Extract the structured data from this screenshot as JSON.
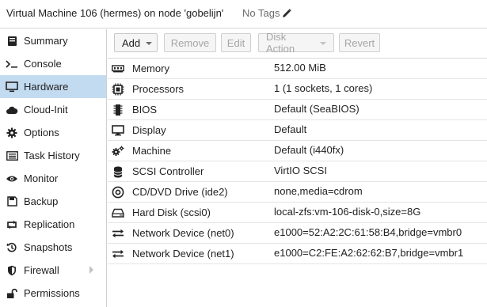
{
  "header": {
    "title": "Virtual Machine 106 (hermes) on node 'gobelijn'",
    "tags_label": "No Tags",
    "tags_icon": "pencil-icon"
  },
  "sidebar": {
    "items": [
      {
        "label": "Summary",
        "icon": "book-icon",
        "selected": false
      },
      {
        "label": "Console",
        "icon": "terminal-icon",
        "selected": false
      },
      {
        "label": "Hardware",
        "icon": "monitor-icon",
        "selected": true
      },
      {
        "label": "Cloud-Init",
        "icon": "cloud-icon",
        "selected": false
      },
      {
        "label": "Options",
        "icon": "gear-icon",
        "selected": false
      },
      {
        "label": "Task History",
        "icon": "list-icon",
        "selected": false
      },
      {
        "label": "Monitor",
        "icon": "eye-icon",
        "selected": false
      },
      {
        "label": "Backup",
        "icon": "floppy-icon",
        "selected": false
      },
      {
        "label": "Replication",
        "icon": "retweet-icon",
        "selected": false
      },
      {
        "label": "Snapshots",
        "icon": "history-icon",
        "selected": false
      },
      {
        "label": "Firewall",
        "icon": "shield-icon",
        "selected": false,
        "has_submenu": true
      },
      {
        "label": "Permissions",
        "icon": "unlock-icon",
        "selected": false
      }
    ]
  },
  "toolbar": {
    "add_label": "Add",
    "remove_label": "Remove",
    "edit_label": "Edit",
    "disk_action_label": "Disk Action",
    "revert_label": "Revert"
  },
  "hardware": [
    {
      "name": "Memory",
      "value": "512.00 MiB",
      "icon": "memory-icon"
    },
    {
      "name": "Processors",
      "value": "1 (1 sockets, 1 cores)",
      "icon": "cpu-icon"
    },
    {
      "name": "BIOS",
      "value": "Default (SeaBIOS)",
      "icon": "microchip-icon"
    },
    {
      "name": "Display",
      "value": "Default",
      "icon": "desktop-icon"
    },
    {
      "name": "Machine",
      "value": "Default (i440fx)",
      "icon": "cogs-icon"
    },
    {
      "name": "SCSI Controller",
      "value": "VirtIO SCSI",
      "icon": "database-icon"
    },
    {
      "name": "CD/DVD Drive (ide2)",
      "value": "none,media=cdrom",
      "icon": "cdrom-icon"
    },
    {
      "name": "Hard Disk (scsi0)",
      "value": "local-zfs:vm-106-disk-0,size=8G",
      "icon": "hdd-icon"
    },
    {
      "name": "Network Device (net0)",
      "value": "e1000=52:A2:2C:61:58:B4,bridge=vmbr0",
      "icon": "exchange-icon"
    },
    {
      "name": "Network Device (net1)",
      "value": "e1000=C2:FE:A2:62:62:B7,bridge=vmbr1",
      "icon": "exchange-icon"
    }
  ],
  "colors": {
    "selected_bg": "#c3dbf1",
    "border": "#d6d6d6",
    "disabled_text": "#a6a6a6"
  }
}
